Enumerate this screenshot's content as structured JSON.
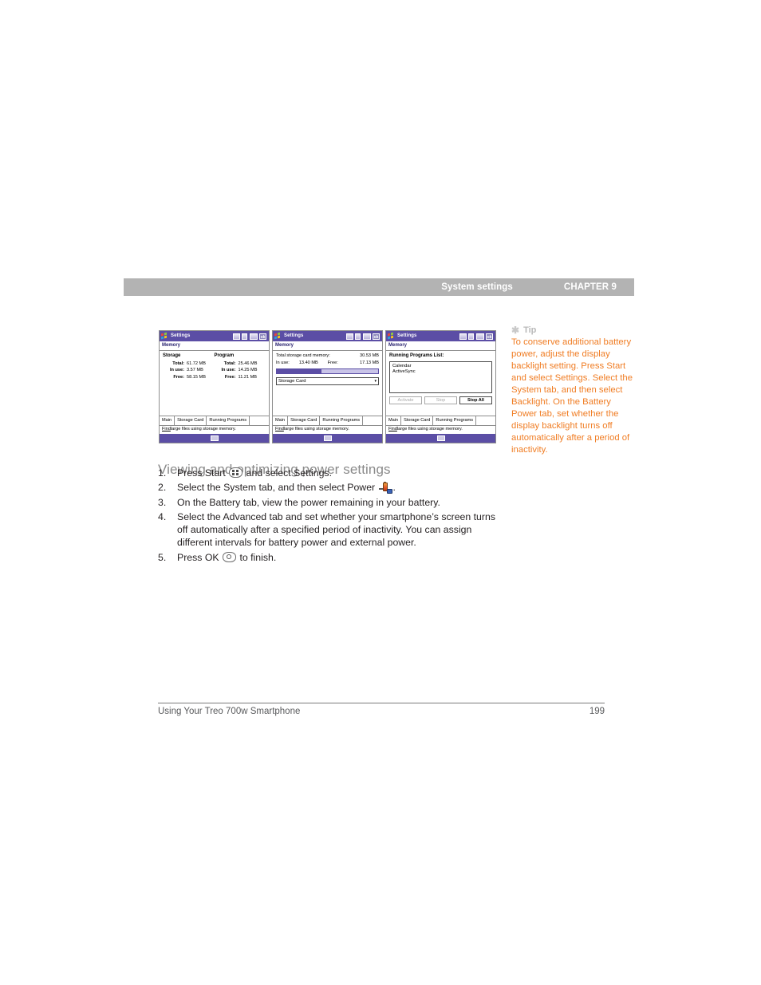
{
  "page_header": {
    "section": "System settings",
    "chapter": "CHAPTER 9"
  },
  "screenshots": [
    {
      "titlebar": {
        "logo": "windows-logo-icon",
        "title": "Settings",
        "icons": [
          "sim-icon",
          "signal-icon",
          "battery-icon",
          "ok-icon"
        ],
        "ok_label": "ok"
      },
      "subtitle": "Memory",
      "storage": {
        "heading": "Storage",
        "rows": [
          {
            "label": "Total:",
            "value": "61.72 MB"
          },
          {
            "label": "In use:",
            "value": "3.57 MB"
          },
          {
            "label": "Free:",
            "value": "58.15 MB"
          }
        ]
      },
      "program": {
        "heading": "Program",
        "rows": [
          {
            "label": "Total:",
            "value": "25.46 MB"
          },
          {
            "label": "In use:",
            "value": "14.25 MB"
          },
          {
            "label": "Free:",
            "value": "11.21 MB"
          }
        ]
      },
      "tabs": [
        "Main",
        "Storage Card",
        "Running Programs"
      ],
      "status_link": "Find",
      "status_text": "large files using storage memory.",
      "softkey": "keyboard-icon"
    },
    {
      "titlebar": {
        "logo": "windows-logo-icon",
        "title": "Settings",
        "icons": [
          "sim-icon",
          "signal-icon",
          "battery-icon",
          "ok-icon"
        ],
        "ok_label": "ok"
      },
      "subtitle": "Memory",
      "total_label": "Total storage card memory:",
      "total_value": "30.53 MB",
      "inuse_label": "In use:",
      "inuse_value": "13.40 MB",
      "free_label": "Free:",
      "free_value": "17.13 MB",
      "progress_percent": 44,
      "combo_value": "Storage Card",
      "combo_caret": "chevron-down-icon",
      "tabs": [
        "Main",
        "Storage Card",
        "Running Programs"
      ],
      "status_link": "Find",
      "status_text": "large files using storage memory.",
      "softkey": "keyboard-icon"
    },
    {
      "titlebar": {
        "logo": "windows-logo-icon",
        "title": "Settings",
        "icons": [
          "sim-icon",
          "signal-icon",
          "battery-icon",
          "ok-icon"
        ],
        "ok_label": "ok"
      },
      "subtitle": "Memory",
      "list_title": "Running Programs List:",
      "list_items": [
        "Calendar",
        "ActiveSync"
      ],
      "buttons": [
        {
          "label": "Activate",
          "disabled": true
        },
        {
          "label": "Stop",
          "disabled": true
        },
        {
          "label": "Stop All",
          "disabled": false
        }
      ],
      "tabs": [
        "Main",
        "Storage Card",
        "Running Programs"
      ],
      "status_link": "Find",
      "status_text": "large files using storage memory.",
      "softkey": "keyboard-icon"
    }
  ],
  "tip": {
    "star": "asterisk-icon",
    "heading": "Tip",
    "body": "To conserve additional battery power, adjust the display backlight setting. Press Start and select Settings. Select the System tab, and then select Backlight. On the Battery Power tab, set whether the display backlight turns off automatically after a period of inactivity."
  },
  "section": {
    "title": "Viewing and optimizing power settings",
    "steps": [
      {
        "num": "1.",
        "pre": "Press Start ",
        "icon": "start-button-icon",
        "post": " and select Settings."
      },
      {
        "num": "2.",
        "pre": "Select the System tab, and then select Power ",
        "icon": "power-settings-icon",
        "post": "."
      },
      {
        "num": "3.",
        "pre": "On the Battery tab, view the power remaining in your battery.",
        "icon": "",
        "post": ""
      },
      {
        "num": "4.",
        "pre": "Select the Advanced tab and set whether your smartphone’s screen turns off automatically after a specified period of inactivity. You can assign different intervals for battery power and external power.",
        "icon": "",
        "post": ""
      },
      {
        "num": "5.",
        "pre": "Press OK ",
        "icon": "ok-button-icon",
        "post": " to finish."
      }
    ]
  },
  "footer": {
    "left": "Using Your Treo 700w Smartphone",
    "right": "199"
  },
  "colors": {
    "header_bar": "#b3b3b3",
    "tip_orange": "#f07d24",
    "titlebar_purple": "#5b4ea5",
    "heading_gray": "#8a8a8a"
  }
}
